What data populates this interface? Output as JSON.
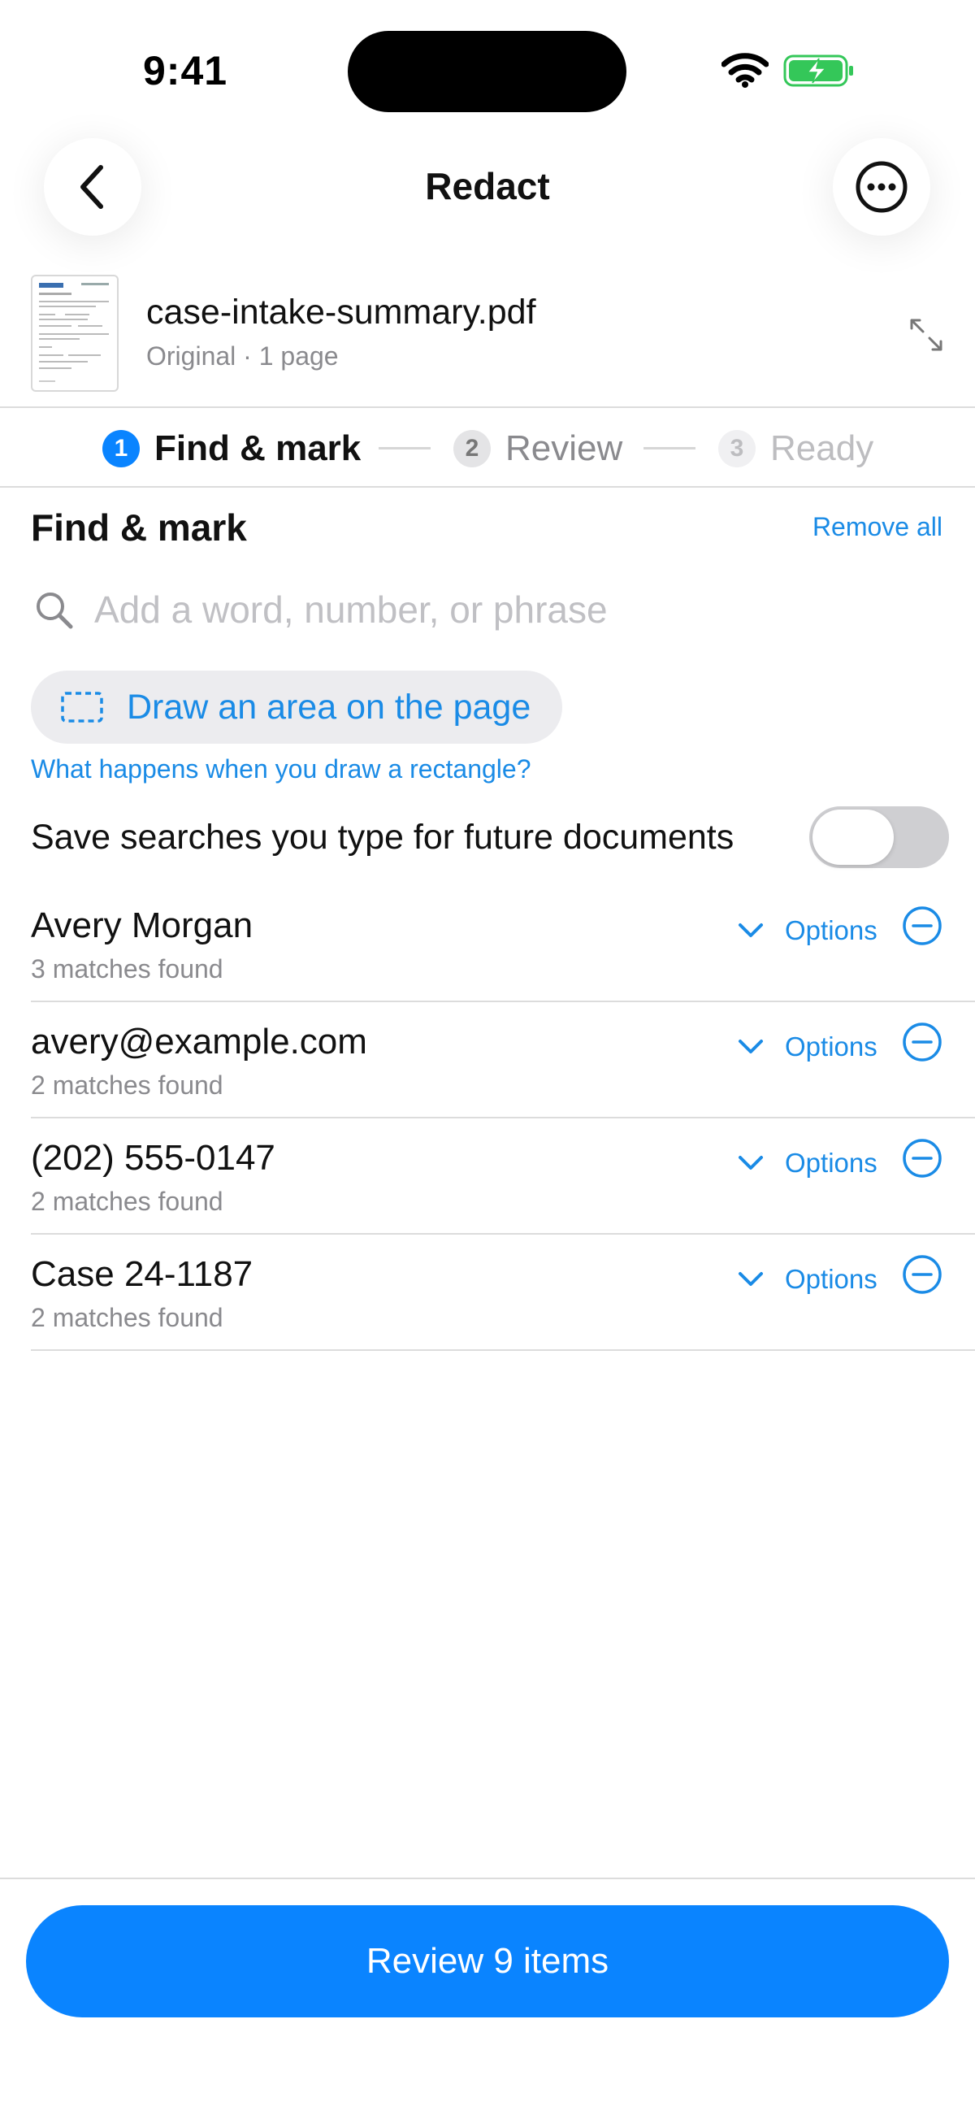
{
  "status_bar": {
    "time": "9:41"
  },
  "nav": {
    "title": "Redact"
  },
  "file": {
    "name": "case-intake-summary.pdf",
    "meta": "Original · 1 page"
  },
  "stepper": {
    "steps": [
      {
        "number": "1",
        "label": "Find & mark",
        "state": "active"
      },
      {
        "number": "2",
        "label": "Review",
        "state": "upcoming"
      },
      {
        "number": "3",
        "label": "Ready",
        "state": "disabled"
      }
    ]
  },
  "section": {
    "title": "Find & mark",
    "remove_all": "Remove all"
  },
  "search": {
    "placeholder": "Add a word, number, or phrase",
    "value": ""
  },
  "draw_area": {
    "label": "Draw an area on the page",
    "help_link": "What happens when you draw a rectangle?"
  },
  "save_searches": {
    "label": "Save searches you type for future documents",
    "enabled": false
  },
  "terms": [
    {
      "title": "Avery Morgan",
      "matches": "3 matches found",
      "options_label": "Options"
    },
    {
      "title": "avery@example.com",
      "matches": "2 matches found",
      "options_label": "Options"
    },
    {
      "title": "(202) 555-0147",
      "matches": "2 matches found",
      "options_label": "Options"
    },
    {
      "title": "Case 24-1187",
      "matches": "2 matches found",
      "options_label": "Options"
    }
  ],
  "footer": {
    "review_button": "Review 9 items"
  },
  "colors": {
    "accent": "#0a84ff",
    "link": "#1a8be6",
    "secondary_text": "#8a8a8e",
    "battery": "#34c759"
  },
  "icons": [
    "wifi-icon",
    "battery-charging-icon",
    "back-chevron-icon",
    "more-icon",
    "document-thumbnail",
    "expand-icon",
    "search-icon",
    "dashed-rectangle-icon",
    "chevron-down-icon",
    "minus-circle-icon"
  ]
}
